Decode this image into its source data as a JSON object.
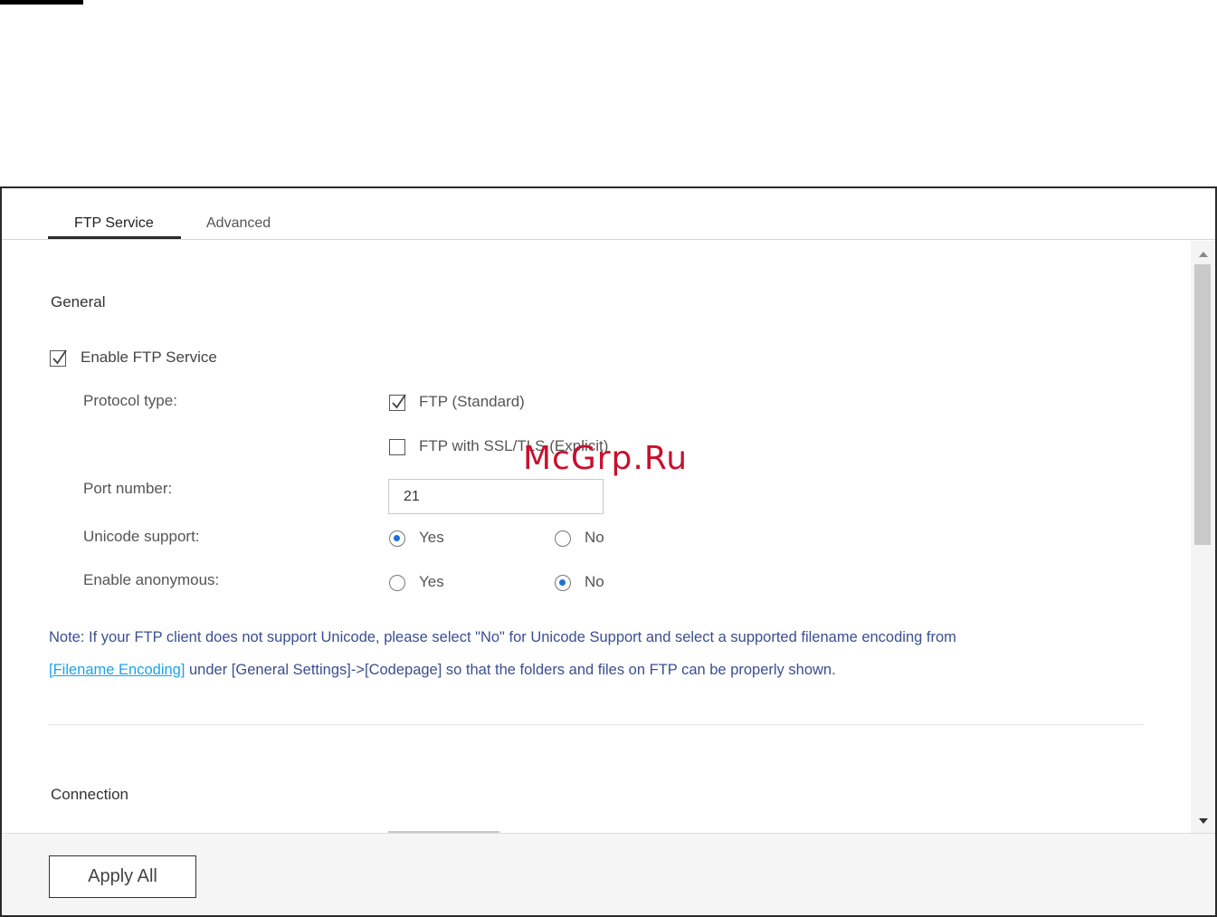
{
  "tabs": [
    {
      "label": "FTP Service",
      "active": true
    },
    {
      "label": "Advanced",
      "active": false
    }
  ],
  "general": {
    "title": "General",
    "enable_ftp": {
      "label": "Enable FTP Service",
      "checked": true
    },
    "protocol": {
      "label": "Protocol type:",
      "options": [
        {
          "label": "FTP (Standard)",
          "checked": true
        },
        {
          "label": "FTP with SSL/TLS (Explicit)",
          "checked": false
        }
      ]
    },
    "port": {
      "label": "Port number:",
      "value": "21"
    },
    "unicode": {
      "label": "Unicode support:",
      "yes": "Yes",
      "no": "No",
      "selected": "Yes"
    },
    "anonymous": {
      "label": "Enable anonymous:",
      "yes": "Yes",
      "no": "No",
      "selected": "No"
    }
  },
  "note": {
    "prefix": "Note: If your FTP client does not support Unicode, please select \"No\" for Unicode Support and select a supported filename encoding from",
    "link": "[Filename Encoding]",
    "suffix": " under [General Settings]->[Codepage] so that the folders and files on FTP can be properly shown."
  },
  "connection": {
    "title": "Connection"
  },
  "footer": {
    "apply_all": "Apply All"
  },
  "watermark": "McGrp.Ru",
  "colors": {
    "accent": "#1e6fd9",
    "link": "#1aa3e8",
    "note": "#3b4f8f",
    "watermark": "#c8102e"
  }
}
